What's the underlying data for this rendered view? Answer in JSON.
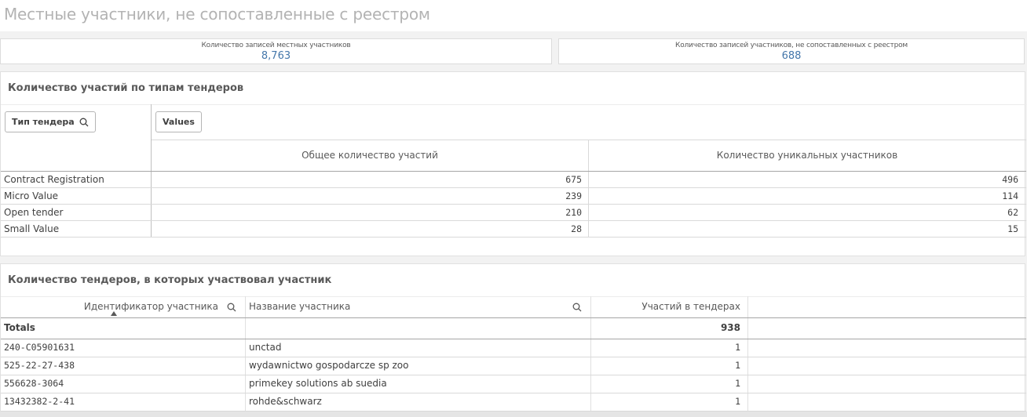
{
  "title": "Местные участники, не сопоставленные с реестром",
  "kpis": [
    {
      "label": "Количество записей местных участников",
      "value": "8,763"
    },
    {
      "label": "Количество записей участников, не сопоставленных с реестром",
      "value": "688"
    }
  ],
  "pivot": {
    "title": "Количество участий по типам тендеров",
    "dim_label": "Тип тендера",
    "values_label": "Values",
    "col1": "Общее количество участий",
    "col2": "Количество уникальных участников",
    "rows": [
      {
        "type": "Contract Registration",
        "total": "675",
        "unique": "496"
      },
      {
        "type": "Micro Value",
        "total": "239",
        "unique": "114"
      },
      {
        "type": "Open tender",
        "total": "210",
        "unique": "62"
      },
      {
        "type": "Small Value",
        "total": "28",
        "unique": "15"
      }
    ]
  },
  "table": {
    "title": "Количество тендеров, в которых участвовал участник",
    "col_id": "Идентификатор участника",
    "col_name": "Название участника",
    "col_count": "Участий в тендерах",
    "totals_label": "Totals",
    "totals_value": "938",
    "rows": [
      {
        "id": "240-C05901631",
        "name": "unctad",
        "count": "1"
      },
      {
        "id": "525-22-27-438",
        "name": "wydawnictwo gospodarcze sp zoo",
        "count": "1"
      },
      {
        "id": "556628-3064",
        "name": "primekey solutions ab suedia",
        "count": "1"
      },
      {
        "id": "13432382-2-41",
        "name": "rohde&schwarz",
        "count": "1"
      }
    ]
  }
}
